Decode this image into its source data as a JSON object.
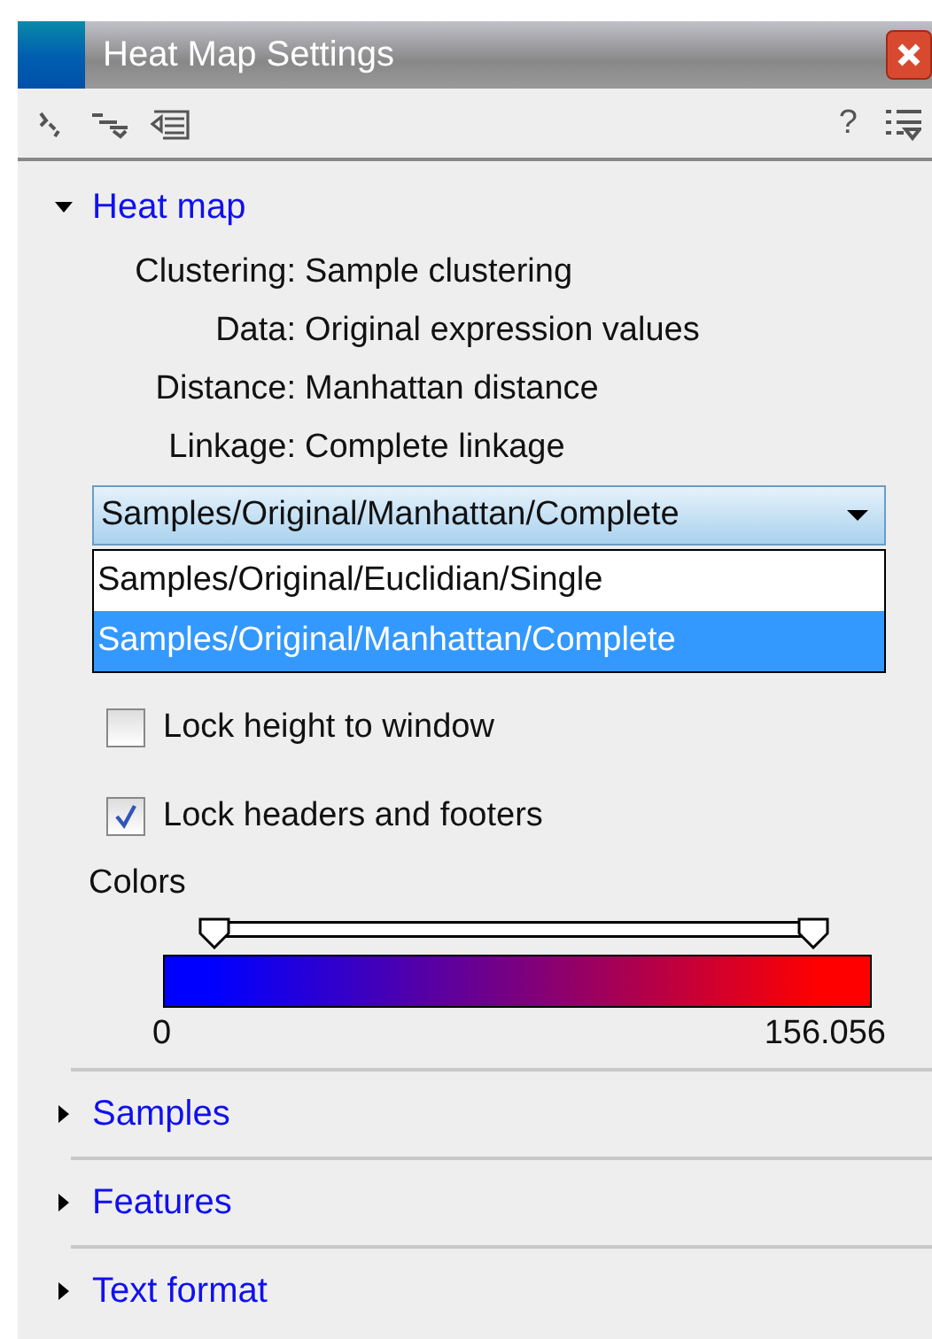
{
  "window": {
    "title": "Heat Map Settings"
  },
  "toolbar": {
    "help": "?"
  },
  "sections": [
    {
      "title": "Heat map",
      "expanded": true,
      "fields": [
        {
          "label": "Clustering:",
          "value": "Sample clustering"
        },
        {
          "label": "Data:",
          "value": "Original expression values"
        },
        {
          "label": "Distance:",
          "value": "Manhattan distance"
        },
        {
          "label": "Linkage:",
          "value": "Complete linkage"
        }
      ],
      "dropdown": {
        "value": "Samples/Original/Manhattan/Complete",
        "expanded": true,
        "options": [
          {
            "label": "Samples/Original/Euclidian/Single",
            "selected": false
          },
          {
            "label": "Samples/Original/Manhattan/Complete",
            "selected": true
          }
        ]
      },
      "checkboxes": [
        {
          "label": "Lock height to window",
          "checked": false
        },
        {
          "label": "Lock headers and footers",
          "checked": true
        }
      ],
      "colors": {
        "label": "Colors",
        "min": "0",
        "max": "156.056",
        "thumbs": [
          {
            "level": 0
          },
          {
            "level": 1
          }
        ]
      }
    },
    {
      "title": "Samples",
      "expanded": false
    },
    {
      "title": "Features",
      "expanded": false
    },
    {
      "title": "Text format",
      "expanded": false
    }
  ]
}
